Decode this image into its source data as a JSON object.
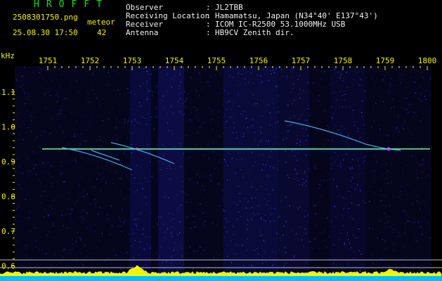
{
  "header": {
    "brand": "HROFFT",
    "filename": "2508301750.png",
    "datetime": "25.08.30 17:50",
    "meteor_label": "meteor",
    "meteor_count": "42"
  },
  "station_info": [
    {
      "label": "Observer",
      "value": "JL2TBB"
    },
    {
      "label": "Receiving Location",
      "value": "Hamamatsu, Japan (N34°40' E137°43')"
    },
    {
      "label": "Receiver",
      "value": "ICOM IC-R2500 53.1000MHz USB"
    },
    {
      "label": "Antenna",
      "value": "HB9CV Zenith dir."
    }
  ],
  "separator": ":",
  "axis": {
    "unit_label": "kHz",
    "time_ticks": [
      "1751",
      "1752",
      "1753",
      "1754",
      "1755",
      "1756",
      "1757",
      "1758",
      "1759",
      "1800"
    ],
    "freq_ticks": [
      "1.1",
      "1.0",
      "0.9",
      "0.8",
      "0.7",
      "0.6"
    ]
  },
  "colors": {
    "background": "#000000",
    "brand": "#13e013",
    "yellow_text": "#f2f200",
    "white_text": "#f0f0f0",
    "carrier_line": "#7cf0a0",
    "trail": "#48c8ff",
    "spectrum_fill": "#00bfff",
    "spectrum_peaks": "#ffff00"
  }
}
